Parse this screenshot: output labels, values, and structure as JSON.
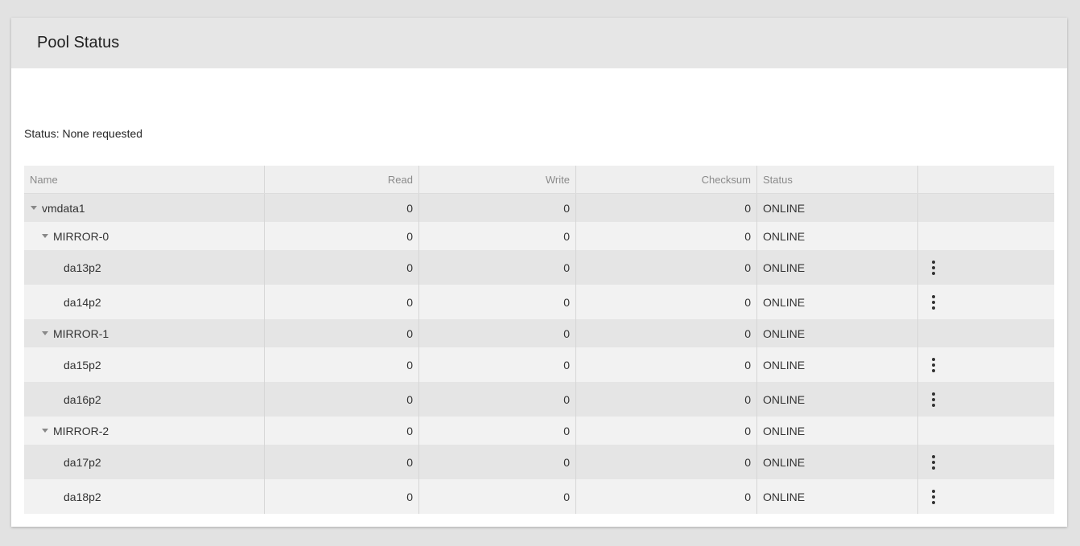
{
  "header": {
    "title": "Pool Status"
  },
  "status": {
    "text": "Status: None requested"
  },
  "table": {
    "columns": {
      "name": "Name",
      "read": "Read",
      "write": "Write",
      "checksum": "Checksum",
      "status": "Status"
    },
    "rows": [
      {
        "name": "vmdata1",
        "read": "0",
        "write": "0",
        "checksum": "0",
        "status": "ONLINE"
      },
      {
        "name": "MIRROR-0",
        "read": "0",
        "write": "0",
        "checksum": "0",
        "status": "ONLINE"
      },
      {
        "name": "da13p2",
        "read": "0",
        "write": "0",
        "checksum": "0",
        "status": "ONLINE"
      },
      {
        "name": "da14p2",
        "read": "0",
        "write": "0",
        "checksum": "0",
        "status": "ONLINE"
      },
      {
        "name": "MIRROR-1",
        "read": "0",
        "write": "0",
        "checksum": "0",
        "status": "ONLINE"
      },
      {
        "name": "da15p2",
        "read": "0",
        "write": "0",
        "checksum": "0",
        "status": "ONLINE"
      },
      {
        "name": "da16p2",
        "read": "0",
        "write": "0",
        "checksum": "0",
        "status": "ONLINE"
      },
      {
        "name": "MIRROR-2",
        "read": "0",
        "write": "0",
        "checksum": "0",
        "status": "ONLINE"
      },
      {
        "name": "da17p2",
        "read": "0",
        "write": "0",
        "checksum": "0",
        "status": "ONLINE"
      },
      {
        "name": "da18p2",
        "read": "0",
        "write": "0",
        "checksum": "0",
        "status": "ONLINE"
      }
    ]
  },
  "icons": {
    "expand": "caret-down-icon",
    "actions": "more-vert-icon"
  }
}
